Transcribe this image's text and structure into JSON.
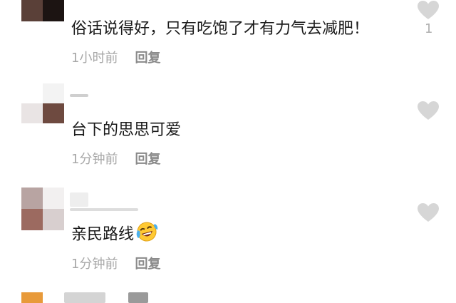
{
  "comments": [
    {
      "text": "俗话说得好，只有吃饱了才有力气去减肥！",
      "time": "1小时前",
      "reply_label": "回复",
      "like_count": "1"
    },
    {
      "text": "台下的思思可爱",
      "time": "1分钟前",
      "reply_label": "回复",
      "like_count": ""
    },
    {
      "text": "亲民路线",
      "emoji": "laughing-tears-emoji",
      "time": "1分钟前",
      "reply_label": "回复",
      "like_count": ""
    }
  ],
  "colors": {
    "heart": "#d6d6d6",
    "meta": "#a8a8a8",
    "reply": "#8a8a8a",
    "text": "#1a1a1a"
  }
}
